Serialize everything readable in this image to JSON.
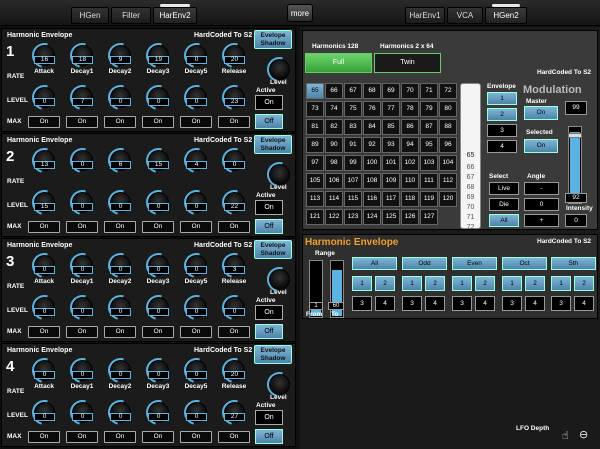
{
  "tabs_left": [
    {
      "label": "HGen",
      "active": false
    },
    {
      "label": "Filter",
      "active": false
    },
    {
      "label": "HarEnv2",
      "active": true
    }
  ],
  "more_label": "more",
  "tabs_right": [
    {
      "label": "HarEnv1",
      "active": false
    },
    {
      "label": "VCA",
      "active": false
    },
    {
      "label": "HGen2",
      "active": true
    }
  ],
  "envelope_common": {
    "title": "Harmonic Envelope",
    "hardcoded": "HardCoded To S2",
    "shadow_label": "Evelope Shadow",
    "rate_label": "RATE",
    "level_label": "LEVEL",
    "max_label": "MAX",
    "active_label": "Active",
    "active_value": "On",
    "off_label": "Off",
    "knob_level_label": "Level",
    "stage_names": [
      "Attack",
      "Decay1",
      "Decay2",
      "Decay3",
      "Decay5",
      "Release"
    ],
    "on_label": "On"
  },
  "envelopes": [
    {
      "number": "1",
      "rate": [
        "16",
        "18",
        "9",
        "19",
        "0",
        "20"
      ],
      "level": [
        "0",
        "7",
        "0",
        "0",
        "0",
        "23"
      ]
    },
    {
      "number": "2",
      "rate": [
        "13",
        "0",
        "6",
        "15",
        "4",
        "0"
      ],
      "level": [
        "15",
        "0",
        "0",
        "0",
        "0",
        "22"
      ]
    },
    {
      "number": "3",
      "rate": [
        "0",
        "0",
        "0",
        "0",
        "0",
        "3"
      ],
      "level": [
        "0",
        "0",
        "0",
        "0",
        "0",
        "0"
      ]
    },
    {
      "number": "4",
      "rate": [
        "0",
        "0",
        "0",
        "0",
        "0",
        "20"
      ],
      "level": [
        "0",
        "0",
        "0",
        "0",
        "0",
        "27"
      ]
    }
  ],
  "harmonics": {
    "label128": "Harmonics 128",
    "label2x64": "Harmonics 2 x 64",
    "full": "Full",
    "twin": "Twin",
    "hardcoded": "HardCoded To S2",
    "grid": [
      [
        "65",
        "66",
        "67",
        "68",
        "69",
        "70",
        "71",
        "72"
      ],
      [
        "73",
        "74",
        "75",
        "76",
        "77",
        "78",
        "79",
        "80"
      ],
      [
        "81",
        "82",
        "83",
        "84",
        "85",
        "86",
        "87",
        "88"
      ],
      [
        "89",
        "90",
        "91",
        "92",
        "93",
        "94",
        "95",
        "96"
      ],
      [
        "97",
        "98",
        "99",
        "100",
        "101",
        "102",
        "103",
        "104"
      ],
      [
        "105",
        "106",
        "107",
        "108",
        "109",
        "110",
        "111",
        "112"
      ],
      [
        "113",
        "114",
        "115",
        "116",
        "117",
        "118",
        "119",
        "120"
      ],
      [
        "121",
        "122",
        "123",
        "124",
        "125",
        "126",
        "127",
        ""
      ]
    ],
    "strip_top": "65",
    "strip_values": [
      "66",
      "67",
      "68",
      "69",
      "70",
      "71",
      "72"
    ]
  },
  "envelope_select": {
    "label": "Envelope",
    "items": [
      "1",
      "2",
      "3",
      "4"
    ],
    "select_label": "Select",
    "select_items": [
      "Live",
      "Die",
      "All"
    ]
  },
  "modulation": {
    "title": "Modulation",
    "master_label": "Master",
    "master_value": "On",
    "master_num": "99",
    "selected_label": "Selected",
    "selected_value": "On",
    "angle_label": "Angle",
    "angle_items": [
      "-",
      "0",
      "+"
    ],
    "angle_value": "0",
    "intensity_label": "Intensity",
    "intensity_value": "92",
    "intensity_fraction": 0.92
  },
  "harmonic_envelope": {
    "title": "Harmonic Envelope",
    "hardcoded": "HardCoded To S2",
    "range_label": "Range",
    "from_label": "From",
    "to_label": "To",
    "from_value": "1",
    "to_value": "60",
    "groups": [
      {
        "label": "All",
        "rows": [
          [
            "1",
            "2"
          ],
          [
            "3",
            "4"
          ]
        ]
      },
      {
        "label": "Odd",
        "rows": [
          [
            "1",
            "2"
          ],
          [
            "3",
            "4"
          ]
        ]
      },
      {
        "label": "Even",
        "rows": [
          [
            "1",
            "2"
          ],
          [
            "3",
            "4"
          ]
        ]
      },
      {
        "label": "Oct",
        "rows": [
          [
            "1",
            "2"
          ],
          [
            "3",
            "4"
          ]
        ]
      },
      {
        "label": "5th",
        "rows": [
          [
            "1",
            "2"
          ],
          [
            "3",
            "4"
          ]
        ]
      }
    ]
  },
  "lfo_label": "LFO Depth"
}
